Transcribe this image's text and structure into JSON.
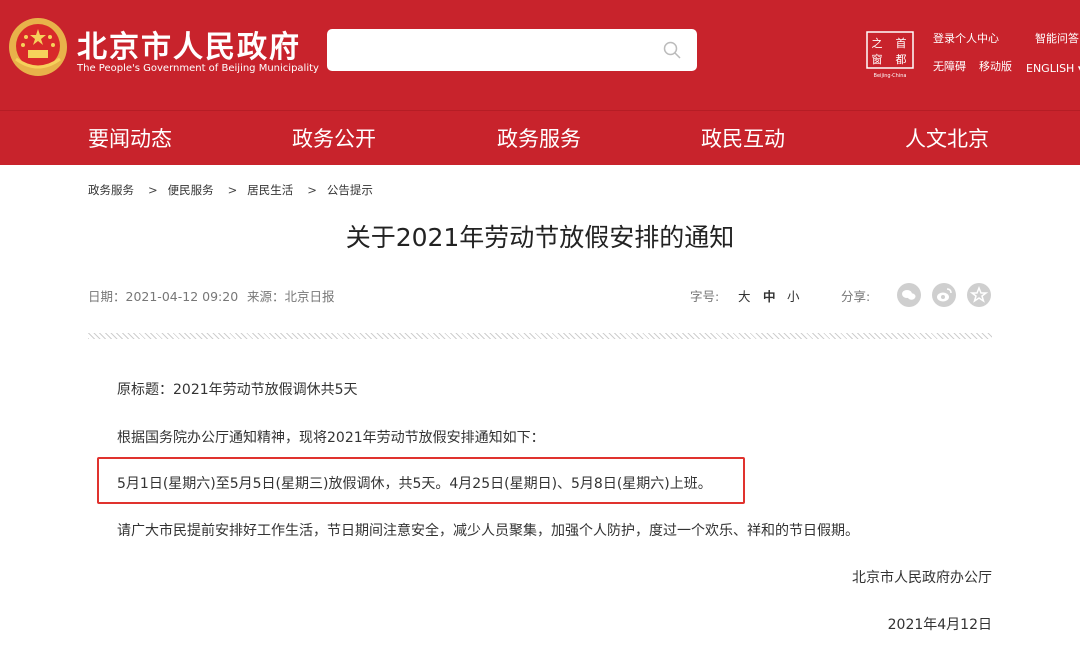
{
  "header": {
    "site_name_cn": "北京市人民政府",
    "site_name_en": "The People's Government of Beijing Municipality",
    "search": {
      "placeholder": ""
    },
    "capital_logo": {
      "chars": [
        "之",
        "首",
        "窗",
        "都"
      ],
      "caption": "Beijing·China"
    },
    "links": {
      "login": "登录个人中心",
      "assistant": "智能问答",
      "accessible": "无障碍",
      "mobile": "移动版",
      "english": "ENGLISH ▾"
    },
    "colors": {
      "brand_red": "#c8232c",
      "highlight_red": "#e0322e"
    }
  },
  "nav": {
    "items": [
      "要闻动态",
      "政务公开",
      "政务服务",
      "政民互动",
      "人文北京"
    ]
  },
  "breadcrumb": [
    "政务服务",
    "便民服务",
    "居民生活",
    "公告提示"
  ],
  "breadcrumb_sep": ">",
  "article": {
    "title": "关于2021年劳动节放假安排的通知",
    "date": "日期：2021-04-12 09:20",
    "source": "来源：北京日报",
    "font_size_label": "字号:",
    "font_sizes": [
      "大",
      "中",
      "小"
    ],
    "share_label": "分享:",
    "share_icons": [
      "wechat-icon",
      "weibo-icon",
      "favorite-icon"
    ],
    "paragraphs": [
      "原标题：2021年劳动节放假调休共5天",
      "根据国务院办公厅通知精神，现将2021年劳动节放假安排通知如下：",
      "5月1日(星期六)至5月5日(星期三)放假调休，共5天。4月25日(星期日)、5月8日(星期六)上班。",
      "请广大市民提前安排好工作生活，节日期间注意安全，减少人员聚集，加强个人防护，度过一个欢乐、祥和的节日假期。"
    ],
    "signature": "北京市人民政府办公厅",
    "sign_date": "2021年4月12日"
  }
}
